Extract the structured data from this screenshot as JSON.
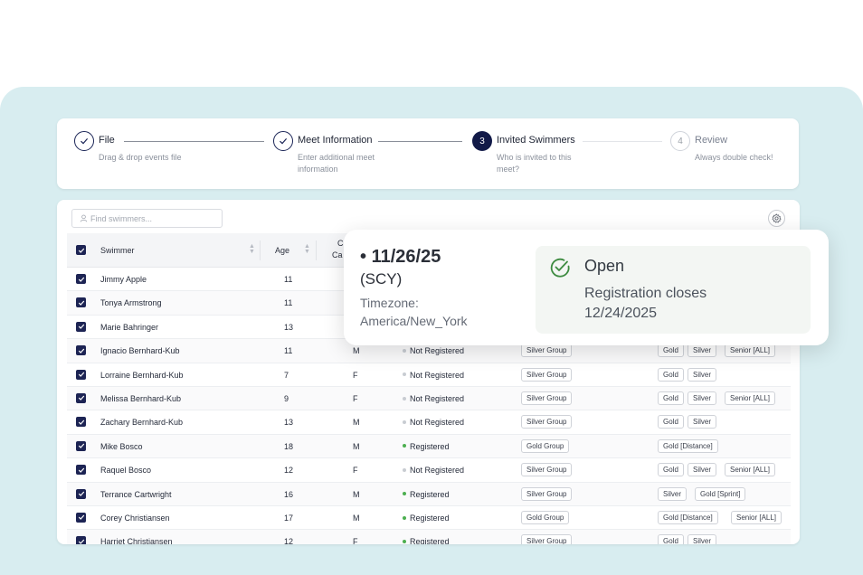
{
  "stepper": [
    {
      "num": "",
      "title": "File",
      "desc": "Drag & drop events file",
      "state": "done"
    },
    {
      "num": "",
      "title": "Meet Information",
      "desc": "Enter additional meet information",
      "state": "done"
    },
    {
      "num": "3",
      "title": "Invited Swimmers",
      "desc": "Who is invited to this meet?",
      "state": "active"
    },
    {
      "num": "4",
      "title": "Review",
      "desc": "Always double check!",
      "state": "todo"
    }
  ],
  "search": {
    "placeholder": "Find swimmers..."
  },
  "table": {
    "headers": {
      "swimmer": "Swimmer",
      "age": "Age",
      "course_top": "C",
      "course_bottom": "Ca"
    },
    "rows": [
      {
        "name": "Jimmy Apple",
        "age": "11",
        "gender": "",
        "status": "",
        "group": "",
        "tags": []
      },
      {
        "name": "Tonya Armstrong",
        "age": "11",
        "gender": "",
        "status": "",
        "group": "",
        "tags": []
      },
      {
        "name": "Marie Bahringer",
        "age": "13",
        "gender": "",
        "status": "",
        "group": "",
        "tags": []
      },
      {
        "name": "Ignacio Bernhard-Kub",
        "age": "11",
        "gender": "M",
        "status": "Not Registered",
        "group": "Silver Group",
        "tags": [
          "Gold",
          "Silver",
          "Senior [ALL]"
        ]
      },
      {
        "name": "Lorraine Bernhard-Kub",
        "age": "7",
        "gender": "F",
        "status": "Not Registered",
        "group": "Silver Group",
        "tags": [
          "Gold",
          "Silver"
        ]
      },
      {
        "name": "Melissa Bernhard-Kub",
        "age": "9",
        "gender": "F",
        "status": "Not Registered",
        "group": "Silver Group",
        "tags": [
          "Gold",
          "Silver",
          "Senior [ALL]"
        ]
      },
      {
        "name": "Zachary Bernhard-Kub",
        "age": "13",
        "gender": "M",
        "status": "Not Registered",
        "group": "Silver Group",
        "tags": [
          "Gold",
          "Silver"
        ]
      },
      {
        "name": "Mike Bosco",
        "age": "18",
        "gender": "M",
        "status": "Registered",
        "group": "Gold Group",
        "tags": [
          "Gold [Distance]"
        ]
      },
      {
        "name": "Raquel Bosco",
        "age": "12",
        "gender": "F",
        "status": "Not Registered",
        "group": "Silver Group",
        "tags": [
          "Gold",
          "Silver",
          "Senior [ALL]"
        ]
      },
      {
        "name": "Terrance Cartwright",
        "age": "16",
        "gender": "M",
        "status": "Registered",
        "group": "Silver Group",
        "tags": [
          "Silver",
          "Gold [Sprint]"
        ]
      },
      {
        "name": "Corey Christiansen",
        "age": "17",
        "gender": "M",
        "status": "Registered",
        "group": "Gold Group",
        "tags": [
          "Gold [Distance]",
          "Senior [ALL]"
        ]
      },
      {
        "name": "Harriet Christiansen",
        "age": "12",
        "gender": "F",
        "status": "Registered",
        "group": "Silver Group",
        "tags": [
          "Gold",
          "Silver"
        ]
      }
    ]
  },
  "popup": {
    "date": "11/26/25",
    "course": "(SCY)",
    "timezone_label": "Timezone:",
    "timezone": "America/New_York",
    "status": "Open",
    "closes_label": "Registration closes",
    "closes_date": "12/24/2025"
  },
  "colors": {
    "accent": "#121a48",
    "registered": "#4caf50",
    "not_registered": "#c8ccd2",
    "check_green": "#3d8b40",
    "background": "#d8edf0"
  }
}
